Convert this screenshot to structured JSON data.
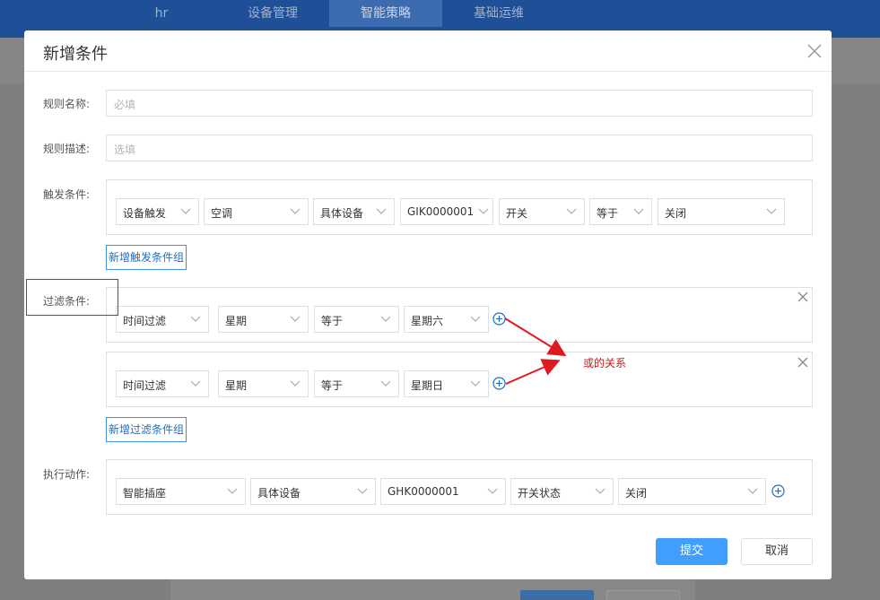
{
  "topnav": {
    "tabs": [
      {
        "label": "hr"
      },
      {
        "label": "设备管理"
      },
      {
        "label": "智能策略",
        "active": true
      },
      {
        "label": "基础运维"
      }
    ]
  },
  "dialog": {
    "title": "新增条件",
    "rule_name": {
      "label": "规则名称:",
      "placeholder": "必填",
      "value": ""
    },
    "rule_desc": {
      "label": "规则描述:",
      "placeholder": "选填",
      "value": ""
    },
    "trigger": {
      "label": "触发条件:",
      "row": [
        "设备触发",
        "空调",
        "具体设备",
        "GIK0000001",
        "开关",
        "等于",
        "关闭"
      ],
      "add_button": "新增触发条件组"
    },
    "filter": {
      "label": "过滤条件:",
      "groups": [
        [
          "时间过滤",
          "星期",
          "等于",
          "星期六"
        ],
        [
          "时间过滤",
          "星期",
          "等于",
          "星期日"
        ]
      ],
      "add_button": "新增过滤条件组"
    },
    "action": {
      "label": "执行动作:",
      "row": [
        "智能插座",
        "具体设备",
        "GHK0000001",
        "开关状态",
        "关闭"
      ]
    },
    "submit_label": "提交",
    "cancel_label": "取消"
  },
  "annotation": {
    "text": "或的关系",
    "color": "#d0141a"
  }
}
